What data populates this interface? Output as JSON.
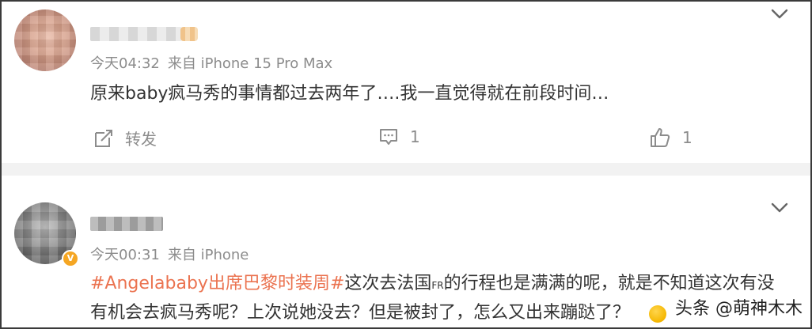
{
  "posts": [
    {
      "time": "今天04:32",
      "source": "来自 iPhone 15 Pro Max",
      "content": "原来baby疯马秀的事情都过去两年了….我一直觉得就在前段时间…",
      "actions": {
        "repost_label": "转发",
        "comment_count": "1",
        "like_count": "1"
      }
    },
    {
      "time": "今天00:31",
      "source": "来自 iPhone",
      "topic": "#Angelababy出席巴黎时装周#",
      "content_line1_a": "这次去法国",
      "content_line1_fr": "FR",
      "content_line1_b": "的行程也是满满的呢，就是不知道这次有没",
      "content_line2": "有机会去疯马秀呢？上次说她没去？但是被封了，怎么又出来蹦跶了？"
    }
  ],
  "watermark": {
    "text": "头条 @萌神木木"
  },
  "colors": {
    "topic": "#eb7350",
    "meta": "#8c8c8c",
    "divider": "#f2f2f2",
    "verified": "#f5a623"
  },
  "icons": [
    "chevron-down-icon",
    "repost-icon",
    "comment-icon",
    "like-icon",
    "verified-icon"
  ]
}
